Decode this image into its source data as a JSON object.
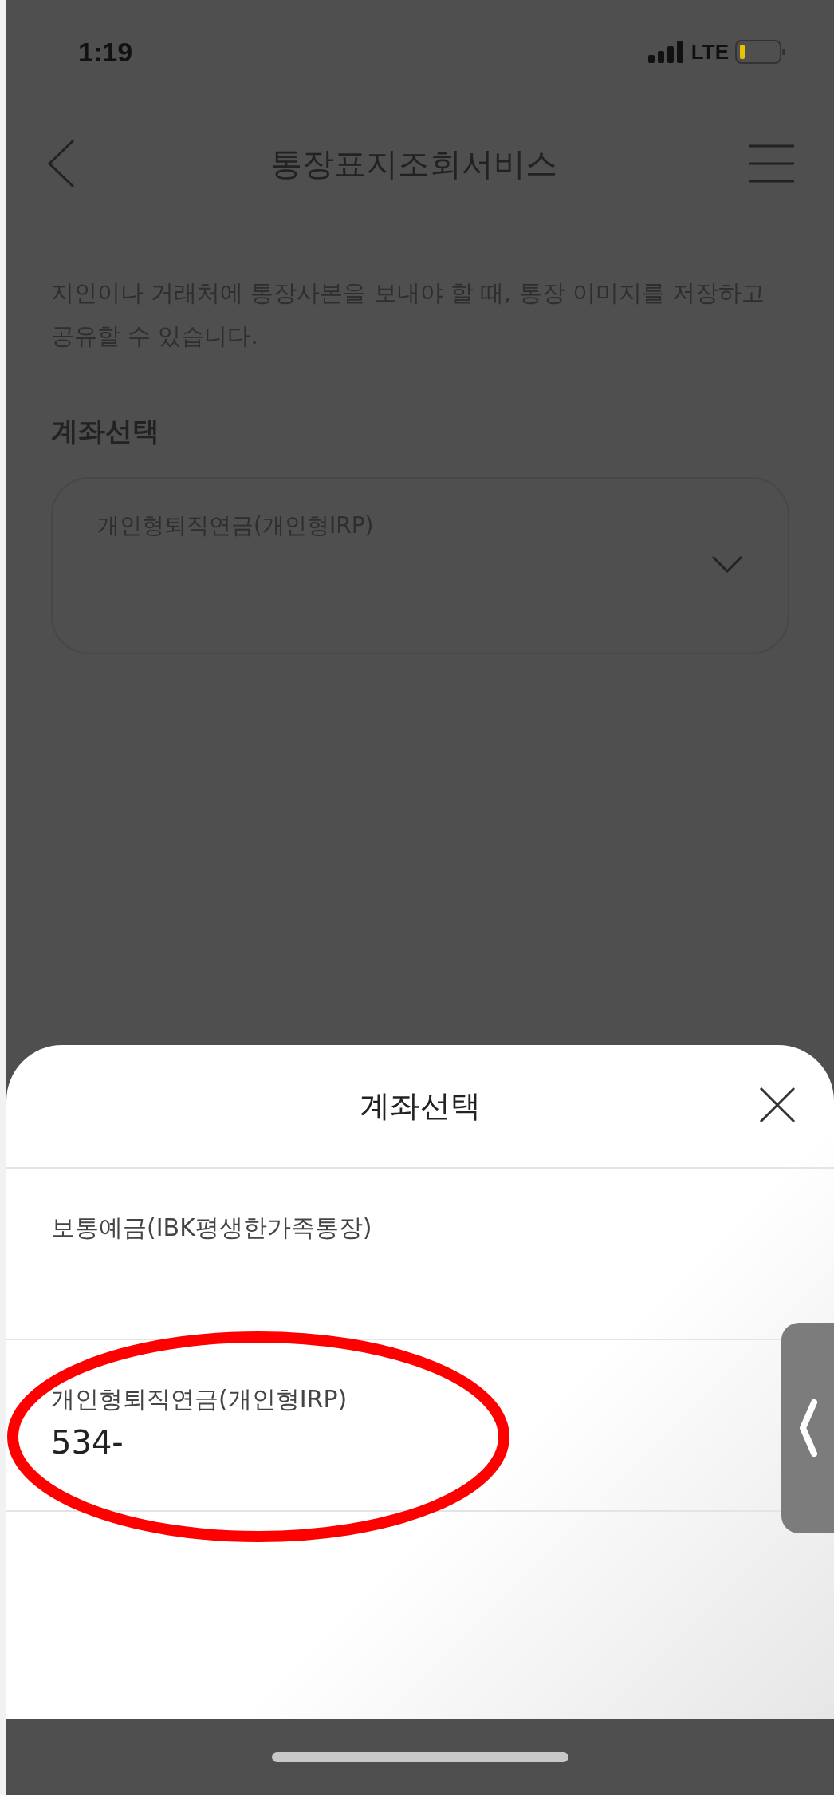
{
  "status_bar": {
    "time": "1:19",
    "network": "LTE"
  },
  "header": {
    "title": "통장표지조회서비스"
  },
  "description": "지인이나 거래처에 통장사본을 보내야 할 때, 통장 이미지를 저장하고 공유할 수 있습니다.",
  "account_select": {
    "label": "계좌선택",
    "value": "개인형퇴직연금(개인형IRP)"
  },
  "sheet": {
    "title": "계좌선택",
    "accounts": [
      {
        "name": "보통예금(IBK평생한가족통장)"
      },
      {
        "name": "개인형퇴직연금(개인형IRP)",
        "number": "534-"
      }
    ]
  }
}
